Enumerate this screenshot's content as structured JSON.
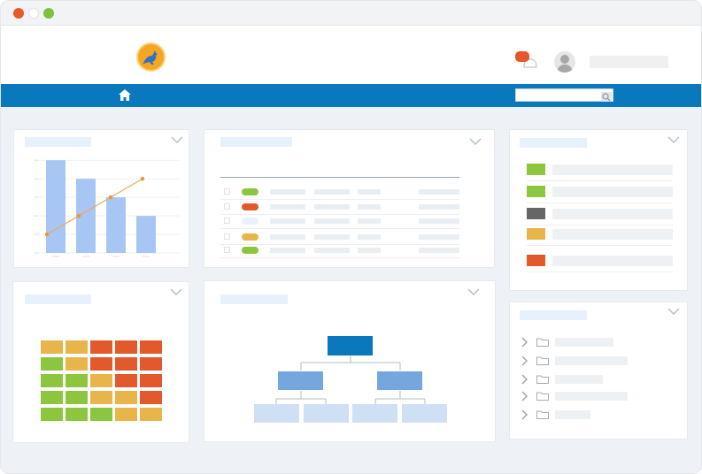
{
  "window": {
    "traffic_lights": [
      {
        "name": "close",
        "color": "#e8562a"
      },
      {
        "name": "minimize",
        "color": "#ffffff"
      },
      {
        "name": "maximize",
        "color": "#7cc142"
      }
    ]
  },
  "header": {
    "logo_icon": "kangaroo-logo",
    "notification_icon": "bell-icon",
    "avatar_icon": "user-icon"
  },
  "navbar": {
    "home_icon": "home-icon",
    "search_icon": "search-icon"
  },
  "colors": {
    "brand_blue": "#0a78bd",
    "green": "#8cc63f",
    "red": "#e25a2c",
    "yellow": "#e8b54a",
    "gray": "#666666",
    "bar_blue": "#a8c6f4",
    "line_orange": "#f2a65a"
  },
  "chart_data": {
    "type": "bar",
    "categories": [
      "",
      "",
      "",
      ""
    ],
    "values": [
      5,
      4,
      3,
      2
    ],
    "series": [
      {
        "values": [
          5,
          4,
          3,
          2
        ]
      },
      {
        "type": "line",
        "values": [
          1,
          2,
          3,
          4
        ]
      }
    ],
    "ylim": [
      0,
      5.2
    ],
    "yticks": [
      0,
      1,
      2,
      3,
      4,
      5
    ],
    "grid": true
  },
  "table_widget": {
    "rows": [
      {
        "status_color": "#8cc63f"
      },
      {
        "status_color": "#e25a2c"
      },
      {
        "status_color": "#eaf3fb"
      },
      {
        "status_color": "#e8b54a"
      },
      {
        "status_color": "#8cc63f"
      }
    ]
  },
  "legend_widget": {
    "items": [
      {
        "color": "#8cc63f"
      },
      {
        "color": "#8cc63f"
      },
      {
        "color": "#666666"
      },
      {
        "color": "#e8b54a"
      },
      {
        "color": "#e25a2c"
      }
    ]
  },
  "heatmap_widget": {
    "grid": [
      [
        "#e8b54a",
        "#e8b54a",
        "#e25a2c",
        "#e25a2c",
        "#e25a2c"
      ],
      [
        "#8cc63f",
        "#e8b54a",
        "#e25a2c",
        "#e25a2c",
        "#e25a2c"
      ],
      [
        "#8cc63f",
        "#8cc63f",
        "#e8b54a",
        "#e25a2c",
        "#e25a2c"
      ],
      [
        "#8cc63f",
        "#8cc63f",
        "#e8b54a",
        "#e8b54a",
        "#e25a2c"
      ],
      [
        "#8cc63f",
        "#8cc63f",
        "#8cc63f",
        "#e8b54a",
        "#e8b54a"
      ]
    ]
  },
  "tree_widget": {
    "items": [
      {
        "icon": "folder-icon"
      },
      {
        "icon": "folder-icon"
      },
      {
        "icon": "folder-icon"
      },
      {
        "icon": "folder-icon"
      },
      {
        "icon": "folder-icon"
      }
    ]
  }
}
